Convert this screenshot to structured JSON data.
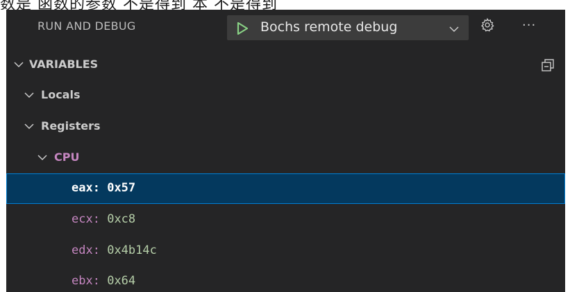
{
  "top_text": "数是 函数的参数 不是得到 本 不是得到",
  "header": {
    "title": "RUN AND DEBUG",
    "launch_config": "Bochs remote debug",
    "more_label": "···",
    "play_icon": "play-icon",
    "chevron_icon": "chevron-down-icon",
    "gear_icon": "gear-icon",
    "play_color": "#89d185"
  },
  "variables": {
    "section_title": "VARIABLES",
    "collapse_icon": "collapse-all-icon",
    "scopes": [
      {
        "label": "Locals",
        "expanded": true
      },
      {
        "label": "Registers",
        "expanded": true
      }
    ],
    "group": {
      "label": "CPU",
      "expanded": true,
      "color": "#c586c0"
    },
    "items": [
      {
        "name": "eax",
        "value": "0x57",
        "selected": true
      },
      {
        "name": "ecx",
        "value": "0xc8",
        "selected": false
      },
      {
        "name": "edx",
        "value": "0x4b14c",
        "selected": false
      },
      {
        "name": "ebx",
        "value": "0x64",
        "selected": false
      }
    ]
  },
  "colors": {
    "panel_bg": "#252526",
    "selected_bg": "#04395e",
    "selected_border": "#007fd4",
    "var_name": "#c586c0",
    "var_value": "#b5cea8"
  }
}
